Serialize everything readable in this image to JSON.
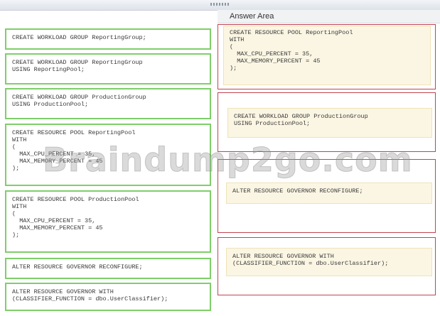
{
  "header": {
    "answer_area": "Answer Area"
  },
  "source_items": [
    "CREATE WORKLOAD GROUP ReportingGroup;",
    "CREATE WORKLOAD GROUP ReportingGroup\nUSING ReportingPool;",
    "CREATE WORKLOAD GROUP ProductionGroup\nUSING ProductionPool;",
    "CREATE RESOURCE POOL ReportingPool\nWITH\n(\n  MAX_CPU_PERCENT = 35,\n  MAX_MEMORY_PERCENT = 45\n);",
    "CREATE RESOURCE POOL ProductionPool\nWITH\n(\n  MAX_CPU_PERCENT = 35,\n  MAX_MEMORY_PERCENT = 45\n);",
    "ALTER RESOURCE GOVERNOR RECONFIGURE;",
    "ALTER RESOURCE GOVERNOR WITH\n(CLASSIFIER_FUNCTION = dbo.UserClassifier);"
  ],
  "answer_items": [
    "CREATE RESOURCE POOL ReportingPool\nWITH\n(\n  MAX_CPU_PERCENT = 35,\n  MAX_MEMORY_PERCENT = 45\n);",
    "CREATE WORKLOAD GROUP ProductionGroup\nUSING ProductionPool;",
    "ALTER RESOURCE GOVERNOR RECONFIGURE;",
    "ALTER RESOURCE GOVERNOR WITH\n(CLASSIFIER_FUNCTION = dbo.UserClassifier);"
  ],
  "watermark": "Braindump2go.com",
  "colors": {
    "source_border": "#7fce6a",
    "target_border": "#c0454f",
    "answer_fill": "#fbf6e3"
  }
}
